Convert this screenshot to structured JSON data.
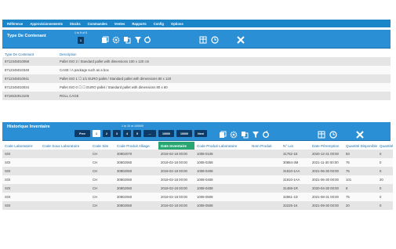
{
  "topnav": [
    "Référence",
    "Approvisionnements",
    "Stocks",
    "Commandes",
    "Ventes",
    "Rapports",
    "Config",
    "Options"
  ],
  "panel1": {
    "title": "Type De Contenant",
    "page_info": "1 to 5 of 5",
    "page": "1",
    "columns": [
      "Type De Contenant",
      "Description"
    ],
    "rows": [
      [
        "8712345010058",
        "Pallet ISO 2 / Standard pallet with dimensions 100 x 120 cm"
      ],
      [
        "8712345010348",
        "CASE / A package such as a box"
      ],
      [
        "8712345010041",
        "Pallet ISO 1 ☐ 1/1 EURO pallet / Standard pallet with dimensions 80 x 120"
      ],
      [
        "8712345010034",
        "Pallet ISO 0 ☐ ☐ EURO pallet / Standard pallet with dimensions 80 x 60"
      ],
      [
        "8716532913105",
        "ROLL CAGE"
      ]
    ]
  },
  "panel2": {
    "title": "Historique Inventaire",
    "page_info": "1 to 10 of 100000",
    "pager": [
      "Prev",
      "1",
      "2",
      "3",
      "4",
      "5",
      "...",
      "10000",
      "10000",
      "Next"
    ],
    "columns": [
      "Code Laboratoire",
      "Code Soux Laboratoire",
      "Code Site",
      "Code Produit Alliage",
      "Date Inventaire",
      "Code Produit Laboratoire",
      "Nom Produit",
      "N° Lot",
      "Date Péremption",
      "Quantité Disponible",
      "Quantité"
    ],
    "rows": [
      [
        "SOI",
        "",
        "CH",
        "30802070",
        "2019-02-18 00:00",
        "1008-0108",
        "",
        "31762-1E",
        "2020-12-31 00:00",
        "93",
        "0"
      ],
      [
        "SOI",
        "",
        "CH",
        "30802060",
        "2019-02-18 00:00",
        "1008-0258",
        "",
        "30884-3M",
        "2021-11-30 00:00",
        "76",
        "0"
      ],
      [
        "SOI",
        "",
        "CH",
        "30802060",
        "2019-02-18 00:00",
        "1008-0408",
        "",
        "31910-1AA",
        "2021-06-30 00:00",
        "75",
        "0"
      ],
      [
        "SOI",
        "",
        "CH",
        "30802060",
        "2019-02-18 00:00",
        "1008-0408",
        "",
        "31910-1AA",
        "2021-06-30 00:00",
        "101",
        "20"
      ],
      [
        "SOI",
        "",
        "CH",
        "30802060",
        "2019-02-18 00:00",
        "1008-0408",
        "",
        "31459-1R",
        "2020-04-30 00:00",
        "8",
        "0"
      ],
      [
        "SOI",
        "",
        "CH",
        "30802060",
        "2019-02-18 00:00",
        "1008-0508",
        "",
        "32861-1D",
        "2021-08-31 00:00",
        "75",
        "0"
      ],
      [
        "SOI",
        "",
        "CH",
        "30802060",
        "2019-02-18 00:00",
        "1008-0508",
        "",
        "32225-1K",
        "2021-09-30 00:00",
        "20",
        "0"
      ]
    ]
  },
  "icons": [
    "export-icon",
    "settings-gear-icon",
    "copy-icon",
    "filter-icon",
    "refresh-icon",
    "columns-icon",
    "clock-icon",
    "close-icon"
  ]
}
